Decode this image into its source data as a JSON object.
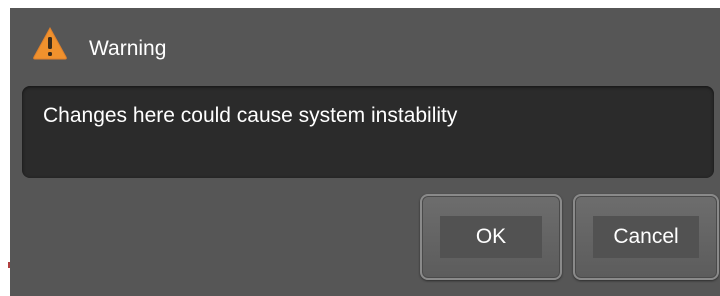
{
  "dialog": {
    "title": "Warning",
    "title_icon": "warning-triangle-icon",
    "message": "Changes here could cause system instability",
    "buttons": {
      "ok_label": "OK",
      "cancel_label": "Cancel"
    }
  },
  "colors": {
    "dialog_background": "#565656",
    "message_background": "#2b2b2b",
    "text": "#ffffff",
    "warning_icon": "#f0912d"
  }
}
